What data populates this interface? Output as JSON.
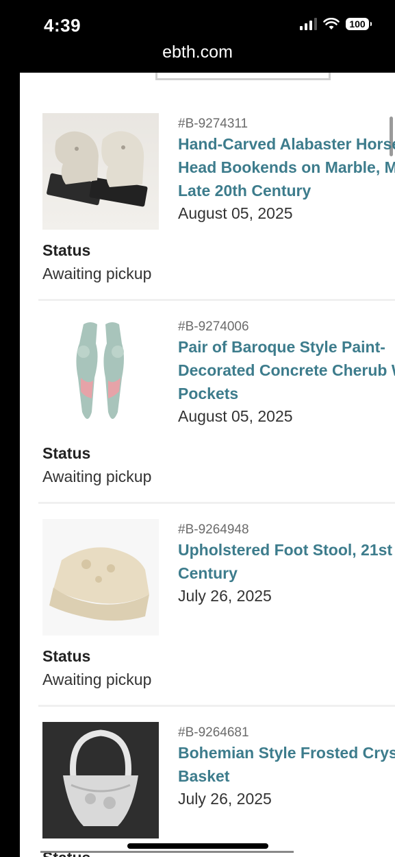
{
  "status_bar": {
    "time": "4:39",
    "url": "ebth.com",
    "battery": "100"
  },
  "items": [
    {
      "lot": "#B-9274311",
      "title_lines": [
        "Hand-Carved Alabaster Horse",
        "Head Bookends on Marble, Mid",
        "Late 20th Century"
      ],
      "date": "August 05, 2025",
      "status_label": "Status",
      "status": "Awaiting pickup"
    },
    {
      "lot": "#B-9274006",
      "title_lines": [
        "Pair of Baroque Style Paint-",
        "Decorated Concrete Cherub Wall",
        "Pockets"
      ],
      "date": "August 05, 2025",
      "status_label": "Status",
      "status": "Awaiting pickup"
    },
    {
      "lot": "#B-9264948",
      "title_lines": [
        "Upholstered Foot Stool, 21st",
        "Century"
      ],
      "date": "July 26, 2025",
      "status_label": "Status",
      "status": "Awaiting pickup"
    },
    {
      "lot": "#B-9264681",
      "title_lines": [
        "Bohemian Style Frosted Crystal",
        "Basket"
      ],
      "date": "July 26, 2025",
      "status_label": "Status",
      "status": ""
    }
  ]
}
